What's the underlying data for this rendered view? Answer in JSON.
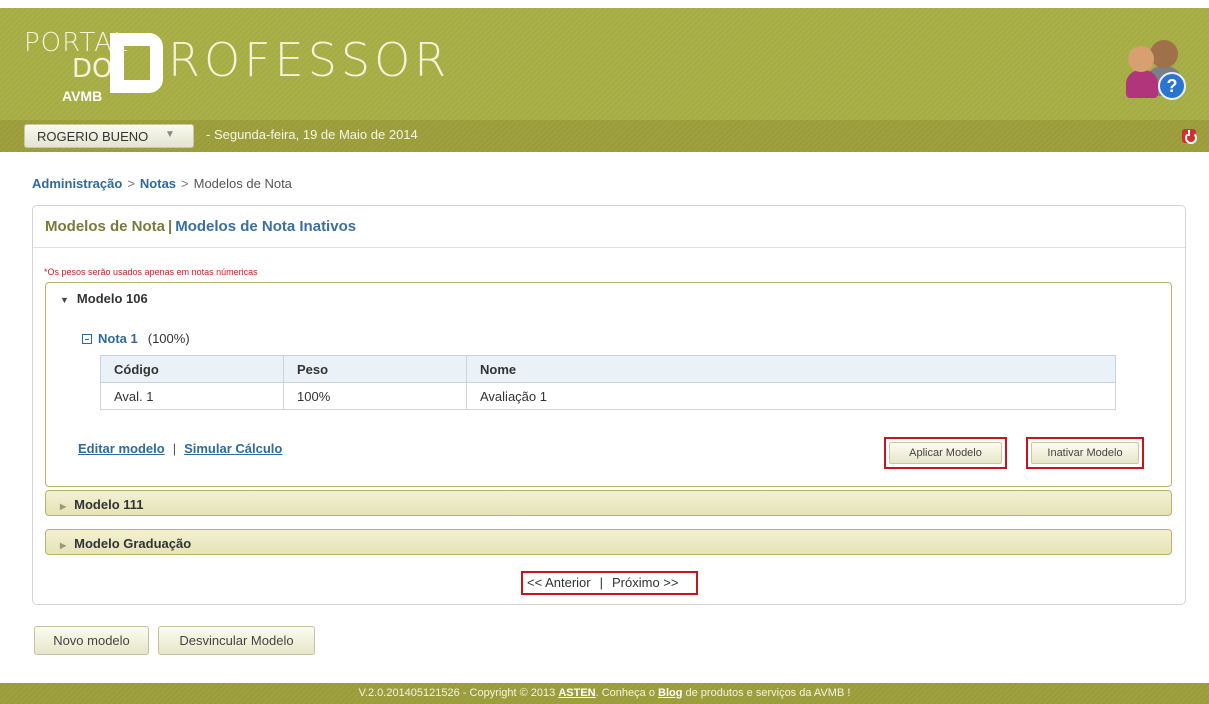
{
  "header": {
    "logo": {
      "portal": "PORTAL",
      "do": "DO",
      "rest": "ROFESSOR",
      "big_letter": "P"
    },
    "org": "AVMB"
  },
  "userbar": {
    "user": "ROGERIO BUENO",
    "date": "-  Segunda-feira, 19 de Maio de 2014"
  },
  "breadcrumb": {
    "items": [
      "Administração",
      "Notas",
      "Modelos de Nota"
    ],
    "sep": ">"
  },
  "panel": {
    "tab_active": "Modelos de Nota",
    "tab_sep": "|",
    "tab_inactive": "Modelos de Nota Inativos",
    "warning": "*Os pesos serão usados apenas em notas númericas",
    "models": [
      {
        "title": "Modelo 106",
        "expanded": true,
        "nota": {
          "label": "Nota 1",
          "pct": "(100%)"
        },
        "table": {
          "headers": [
            "Código",
            "Peso",
            "Nome"
          ],
          "rows": [
            [
              "Aval. 1",
              "100%",
              "Avaliação 1"
            ]
          ]
        },
        "links": {
          "edit": "Editar modelo",
          "sep": "|",
          "simulate": "Simular Cálculo"
        },
        "buttons": {
          "apply": "Aplicar Modelo",
          "inactivate": "Inativar Modelo"
        }
      },
      {
        "title": "Modelo 111",
        "expanded": false
      },
      {
        "title": "Modelo Graduação",
        "expanded": false
      }
    ],
    "pager": {
      "prev": "<< Anterior",
      "sep": "|",
      "next": "Próximo >>"
    }
  },
  "actions": {
    "new": "Novo modelo",
    "unlink": "Desvincular Modelo"
  },
  "footer": {
    "part1": "V.2.0.201405121526 - Copyright © 2013 ",
    "asten": "ASTEN",
    "part2": ". Conheça o ",
    "blog": "Blog",
    "part3": " de produtos e serviços da AVMB !"
  },
  "colors": {
    "header_olive": "#a6ac44",
    "link_blue": "#2f6a9a",
    "highlight_red": "#c8141c",
    "warning_red": "#cc2222"
  }
}
